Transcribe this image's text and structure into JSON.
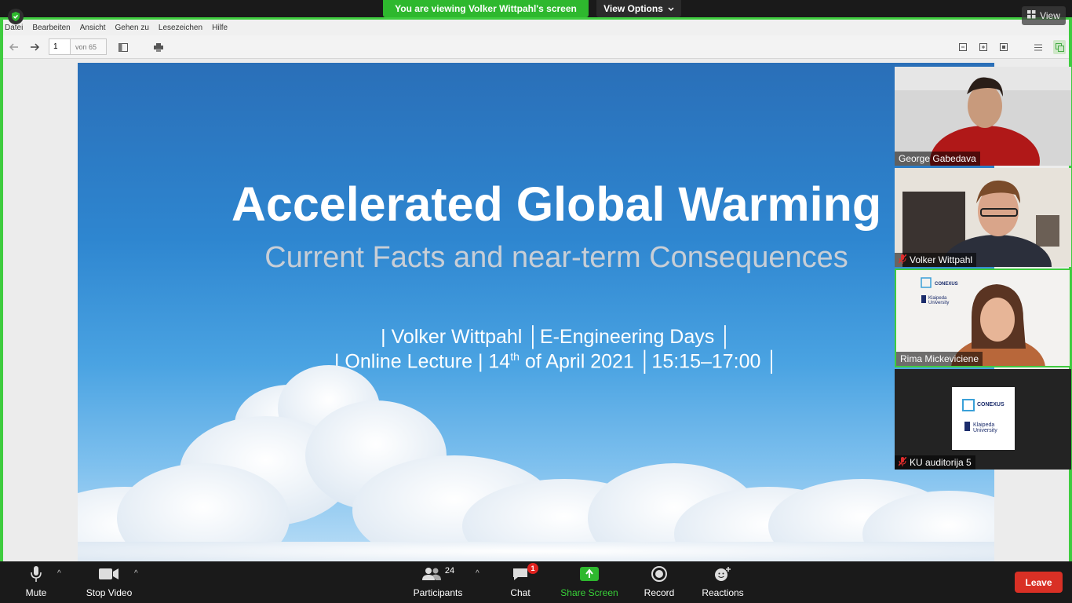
{
  "window": {
    "viewing_banner": "You are viewing Volker Wittpahl's screen",
    "view_options_label": "View Options",
    "view_label": "View"
  },
  "pdf_viewer": {
    "menu": [
      "Datei",
      "Bearbeiten",
      "Ansicht",
      "Gehen zu",
      "Lesezeichen",
      "Hilfe"
    ],
    "page_current": "1",
    "page_total": "von 65"
  },
  "slide": {
    "title": "Accelerated Global Warming",
    "subtitle": "Current Facts and near-term Consequences",
    "line1": "| Volker Wittpahl │E-Engineering Days │",
    "line2_prefix": "| Online Lecture | 14",
    "line2_sup": "th",
    "line2_suffix": " of April 2021 │15:15–17:00 │"
  },
  "participants_tiles": [
    {
      "name": "George Gabedava",
      "muted": false
    },
    {
      "name": "Volker Wittpahl",
      "muted": true
    },
    {
      "name": "Rima Mickeviciene",
      "muted": false,
      "active_speaker": true
    },
    {
      "name": "KU auditorija 5",
      "muted": true
    }
  ],
  "logo_text": {
    "conexus": "CONEXUS",
    "university_line1": "Klaipeda",
    "university_line2": "University"
  },
  "controls": {
    "mute": "Mute",
    "stop_video": "Stop Video",
    "participants": "Participants",
    "participants_count": "24",
    "chat": "Chat",
    "chat_badge": "1",
    "share_screen": "Share Screen",
    "record": "Record",
    "reactions": "Reactions",
    "leave": "Leave"
  },
  "colors": {
    "accent_green": "#2eb82e",
    "leave_red": "#d93025",
    "sky_blue": "#2e86d0"
  }
}
